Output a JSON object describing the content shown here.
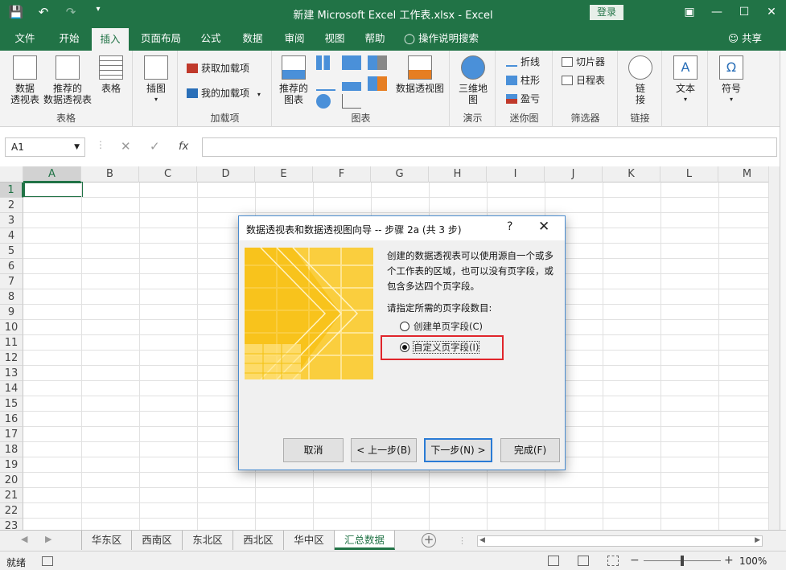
{
  "window": {
    "title": "新建 Microsoft Excel 工作表.xlsx  -  Excel",
    "login_label": "登录",
    "min_icon": "minimize-icon",
    "max_icon": "maximize-icon",
    "close_icon": "close-icon"
  },
  "ribbon_tabs": [
    "文件",
    "开始",
    "插入",
    "页面布局",
    "公式",
    "数据",
    "审阅",
    "视图",
    "帮助",
    "操作说明搜索"
  ],
  "active_tab": "插入",
  "share_label": "共享",
  "ribbon": {
    "pivot_table": "数据\n透视表",
    "recommended_pivot": "推荐的\n数据透视表",
    "table": "表格",
    "group_tables": "表格",
    "illustrations": "插图",
    "get_addins": "获取加载项",
    "my_addins": "我的加载项",
    "group_addins": "加载项",
    "recommended_charts": "推荐的\n图表",
    "pivot_chart": "数据透视图",
    "group_charts": "图表",
    "map3d": "三维地\n图",
    "group_tours": "演示",
    "spark_line": "折线",
    "spark_column": "柱形",
    "spark_winloss": "盈亏",
    "group_sparklines": "迷你图",
    "slicer": "切片器",
    "timeline": "日程表",
    "group_filters": "筛选器",
    "link": "链\n接",
    "group_links": "链接",
    "text": "文本",
    "symbol": "符号"
  },
  "formula_bar": {
    "name_box": "A1",
    "fx_label": "fx",
    "formula_value": ""
  },
  "columns": [
    "A",
    "B",
    "C",
    "D",
    "E",
    "F",
    "G",
    "H",
    "I",
    "J",
    "K",
    "L",
    "M"
  ],
  "rows": [
    "1",
    "2",
    "3",
    "4",
    "5",
    "6",
    "7",
    "8",
    "9",
    "10",
    "11",
    "12",
    "13",
    "14",
    "15",
    "16",
    "17",
    "18",
    "19",
    "20",
    "21",
    "22",
    "23"
  ],
  "sheets": [
    "华东区",
    "西南区",
    "东北区",
    "西北区",
    "华中区",
    "汇总数据"
  ],
  "active_sheet": "汇总数据",
  "status": {
    "ready": "就绪",
    "zoom": "100%",
    "zoom_level": 1.0
  },
  "dialog": {
    "title": "数据透视表和数据透视图向导 -- 步骤 2a (共 3 步)",
    "help": "?",
    "description": "创建的数据透视表可以使用源自一个或多个工作表的区域，也可以没有页字段，或包含多达四个页字段。",
    "prompt": "请指定所需的页字段数目:",
    "options": [
      {
        "label": "创建单页字段(C)",
        "selected": false
      },
      {
        "label": "自定义页字段(I)",
        "selected": true
      }
    ],
    "buttons": {
      "cancel": "取消",
      "back": "< 上一步(B)",
      "next": "下一步(N) >",
      "finish": "完成(F)"
    },
    "highlight_color": "#e0252b"
  },
  "colors": {
    "excel_green": "#217346",
    "dialog_border": "#4a8ccf"
  }
}
